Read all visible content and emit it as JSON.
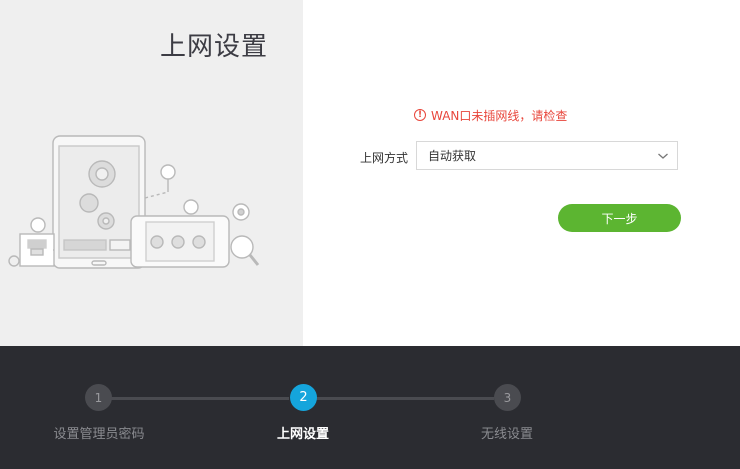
{
  "page": {
    "title": "上网设置"
  },
  "form": {
    "error": "WAN口未插网线，请检查",
    "error_icon": "exclamation-circle-icon",
    "connection_label": "上网方式",
    "connection_value": "自动获取",
    "next_label": "下一步"
  },
  "steps": [
    {
      "number": "1",
      "label": "设置管理员密码",
      "state": "done"
    },
    {
      "number": "2",
      "label": "上网设置",
      "state": "active"
    },
    {
      "number": "3",
      "label": "无线设置",
      "state": "pending"
    }
  ],
  "colors": {
    "accent": "#15a5dc",
    "primary_button": "#5cb531",
    "error": "#e8463b",
    "footer": "#2b2c31"
  }
}
